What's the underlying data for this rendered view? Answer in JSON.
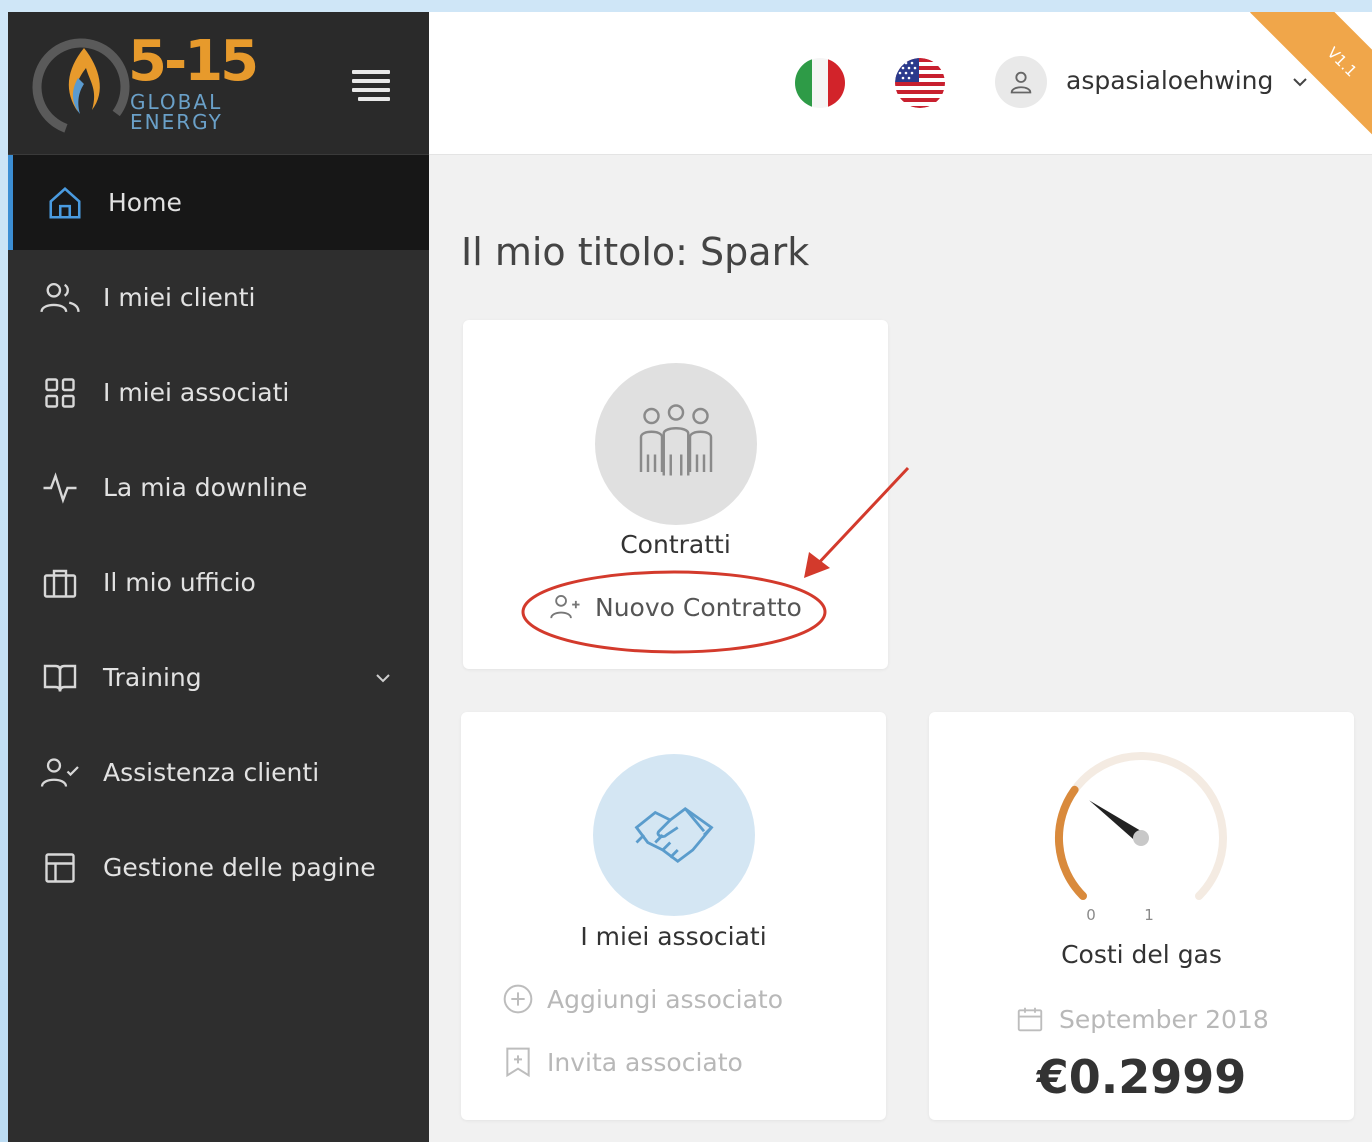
{
  "brand": {
    "logo_number": "5-15",
    "logo_line1": "GLOBAL",
    "logo_line2": "ENERGY"
  },
  "sidebar": {
    "items": [
      {
        "label": "Home",
        "icon": "home-icon",
        "active": true
      },
      {
        "label": "I miei clienti",
        "icon": "users-icon"
      },
      {
        "label": "I miei associati",
        "icon": "grid-icon"
      },
      {
        "label": "La mia downline",
        "icon": "activity-icon"
      },
      {
        "label": "Il mio ufficio",
        "icon": "briefcase-icon"
      },
      {
        "label": "Training",
        "icon": "book-icon",
        "has_submenu": true
      },
      {
        "label": "Assistenza clienti",
        "icon": "user-check-icon"
      },
      {
        "label": "Gestione delle pagine",
        "icon": "layout-icon"
      }
    ]
  },
  "topbar": {
    "username": "aspasialoehwing",
    "version": "V1.1"
  },
  "main": {
    "title": "Il mio titolo: Spark",
    "contracts_card": {
      "title": "Contratti",
      "action": "Nuovo Contratto"
    },
    "associates_card": {
      "title": "I miei associati",
      "action_add": "Aggiungi associato",
      "action_invite": "Invita associato"
    },
    "gas_card": {
      "title": "Costi del gas",
      "gauge_min": "0",
      "gauge_max": "1",
      "gauge_value": 0.2999,
      "date": "September 2018",
      "price": "€0.2999"
    }
  },
  "colors": {
    "sidebar_bg": "#2e2e2e",
    "active_bg": "#171717",
    "accent": "#3c8ed3",
    "logo_orange": "#e79a2c",
    "gauge_orange": "#d98a3c",
    "annotation_red": "#d33a2c"
  }
}
